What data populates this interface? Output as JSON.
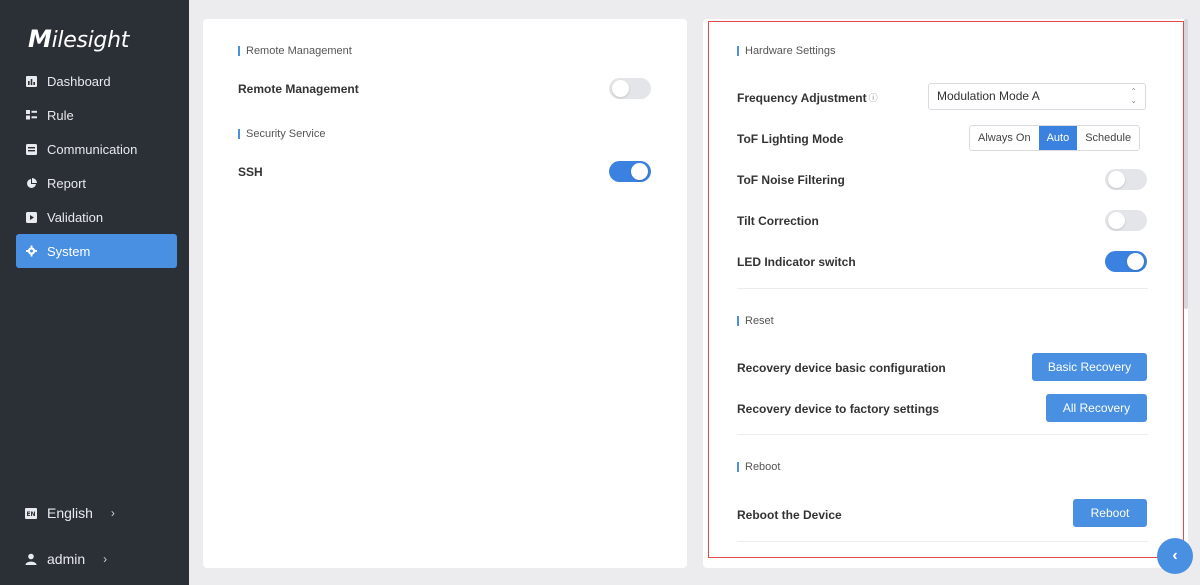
{
  "brand": {
    "name_initial": "M",
    "name_rest": "ilesight"
  },
  "sidebar": {
    "items": [
      {
        "label": "Dashboard",
        "icon": "bar-chart-icon",
        "active": false
      },
      {
        "label": "Rule",
        "icon": "rule-icon",
        "active": false
      },
      {
        "label": "Communication",
        "icon": "communication-icon",
        "active": false
      },
      {
        "label": "Report",
        "icon": "pie-chart-icon",
        "active": false
      },
      {
        "label": "Validation",
        "icon": "validation-icon",
        "active": false
      },
      {
        "label": "System",
        "icon": "gear-icon",
        "active": true
      }
    ],
    "language": {
      "label": "English",
      "icon": "language-icon",
      "badge": "EN"
    },
    "user": {
      "label": "admin",
      "icon": "user-icon"
    }
  },
  "left_panel": {
    "remote_section": "Remote Management",
    "remote_label": "Remote Management",
    "remote_enabled": false,
    "security_section": "Security Service",
    "ssh_label": "SSH",
    "ssh_enabled": true
  },
  "right_panel": {
    "hardware_section": "Hardware Settings",
    "frequency_label": "Frequency Adjustment",
    "frequency_value": "Modulation Mode A",
    "tof_lighting_label": "ToF Lighting Mode",
    "tof_lighting_options": [
      "Always On",
      "Auto",
      "Schedule"
    ],
    "tof_lighting_selected": "Auto",
    "tof_noise_label": "ToF Noise Filtering",
    "tof_noise_enabled": false,
    "tilt_label": "Tilt Correction",
    "tilt_enabled": false,
    "led_label": "LED Indicator switch",
    "led_enabled": true,
    "reset_section": "Reset",
    "basic_recovery_label": "Recovery device basic configuration",
    "basic_recovery_button": "Basic Recovery",
    "factory_label": "Recovery device to factory settings",
    "factory_button": "All Recovery",
    "reboot_section": "Reboot",
    "reboot_label": "Reboot the Device",
    "reboot_button": "Reboot"
  },
  "colors": {
    "accent": "#4a90e2",
    "sidebar_bg": "#2b2f36",
    "highlight_border": "#e34a4a"
  }
}
